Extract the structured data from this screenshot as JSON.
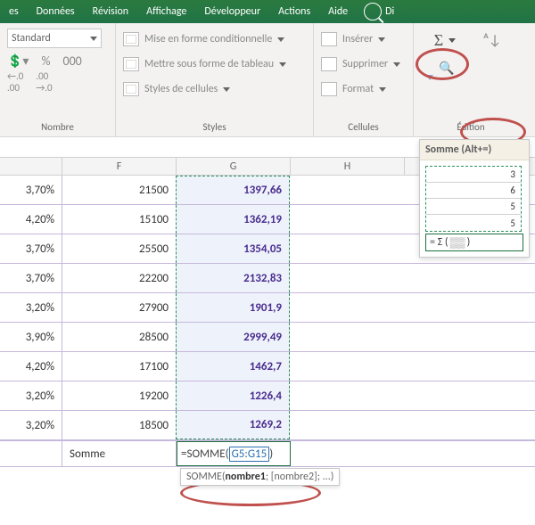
{
  "menu": {
    "items": [
      "es",
      "Données",
      "Révision",
      "Affichage",
      "Développeur",
      "Actions",
      "Aide"
    ],
    "search_fragment": "Di"
  },
  "ribbon": {
    "number": {
      "format": "Standard",
      "label": "Nombre"
    },
    "styles": {
      "label": "Styles",
      "cond": "Mise en forme conditionnelle",
      "table": "Mettre sous forme de tableau",
      "cell_styles": "Styles de cellules"
    },
    "cells": {
      "label": "Cellules",
      "insert": "Insérer",
      "delete": "Supprimer",
      "format": "Format"
    },
    "edit": {
      "label": "Édition"
    }
  },
  "tooltip": {
    "title": "Somme (Alt+=)",
    "values": [
      "3",
      "6",
      "5",
      "5"
    ],
    "sum_prefix": "= Σ ("
  },
  "columns": {
    "F": "F",
    "G": "G",
    "H": "H"
  },
  "table": [
    {
      "e": "3,70%",
      "f": "21500",
      "g": "1397,66"
    },
    {
      "e": "4,20%",
      "f": "15100",
      "g": "1362,19"
    },
    {
      "e": "3,70%",
      "f": "25500",
      "g": "1354,05"
    },
    {
      "e": "3,70%",
      "f": "22200",
      "g": "2132,83"
    },
    {
      "e": "3,20%",
      "f": "27900",
      "g": "1901,9"
    },
    {
      "e": "3,90%",
      "f": "28500",
      "g": "2999,49"
    },
    {
      "e": "4,20%",
      "f": "17100",
      "g": "1462,7"
    },
    {
      "e": "3,20%",
      "f": "19200",
      "g": "1226,4"
    },
    {
      "e": "3,20%",
      "f": "18500",
      "g": "1269,2"
    }
  ],
  "sumrow": {
    "label": "Somme",
    "formula_prefix": "=SOMME(",
    "formula_ref": "G5:G15",
    "formula_suffix": ")"
  },
  "hint": {
    "fn": "SOMME(",
    "arg1": "nombre1",
    "rest": "; [nombre2]; ...)"
  }
}
